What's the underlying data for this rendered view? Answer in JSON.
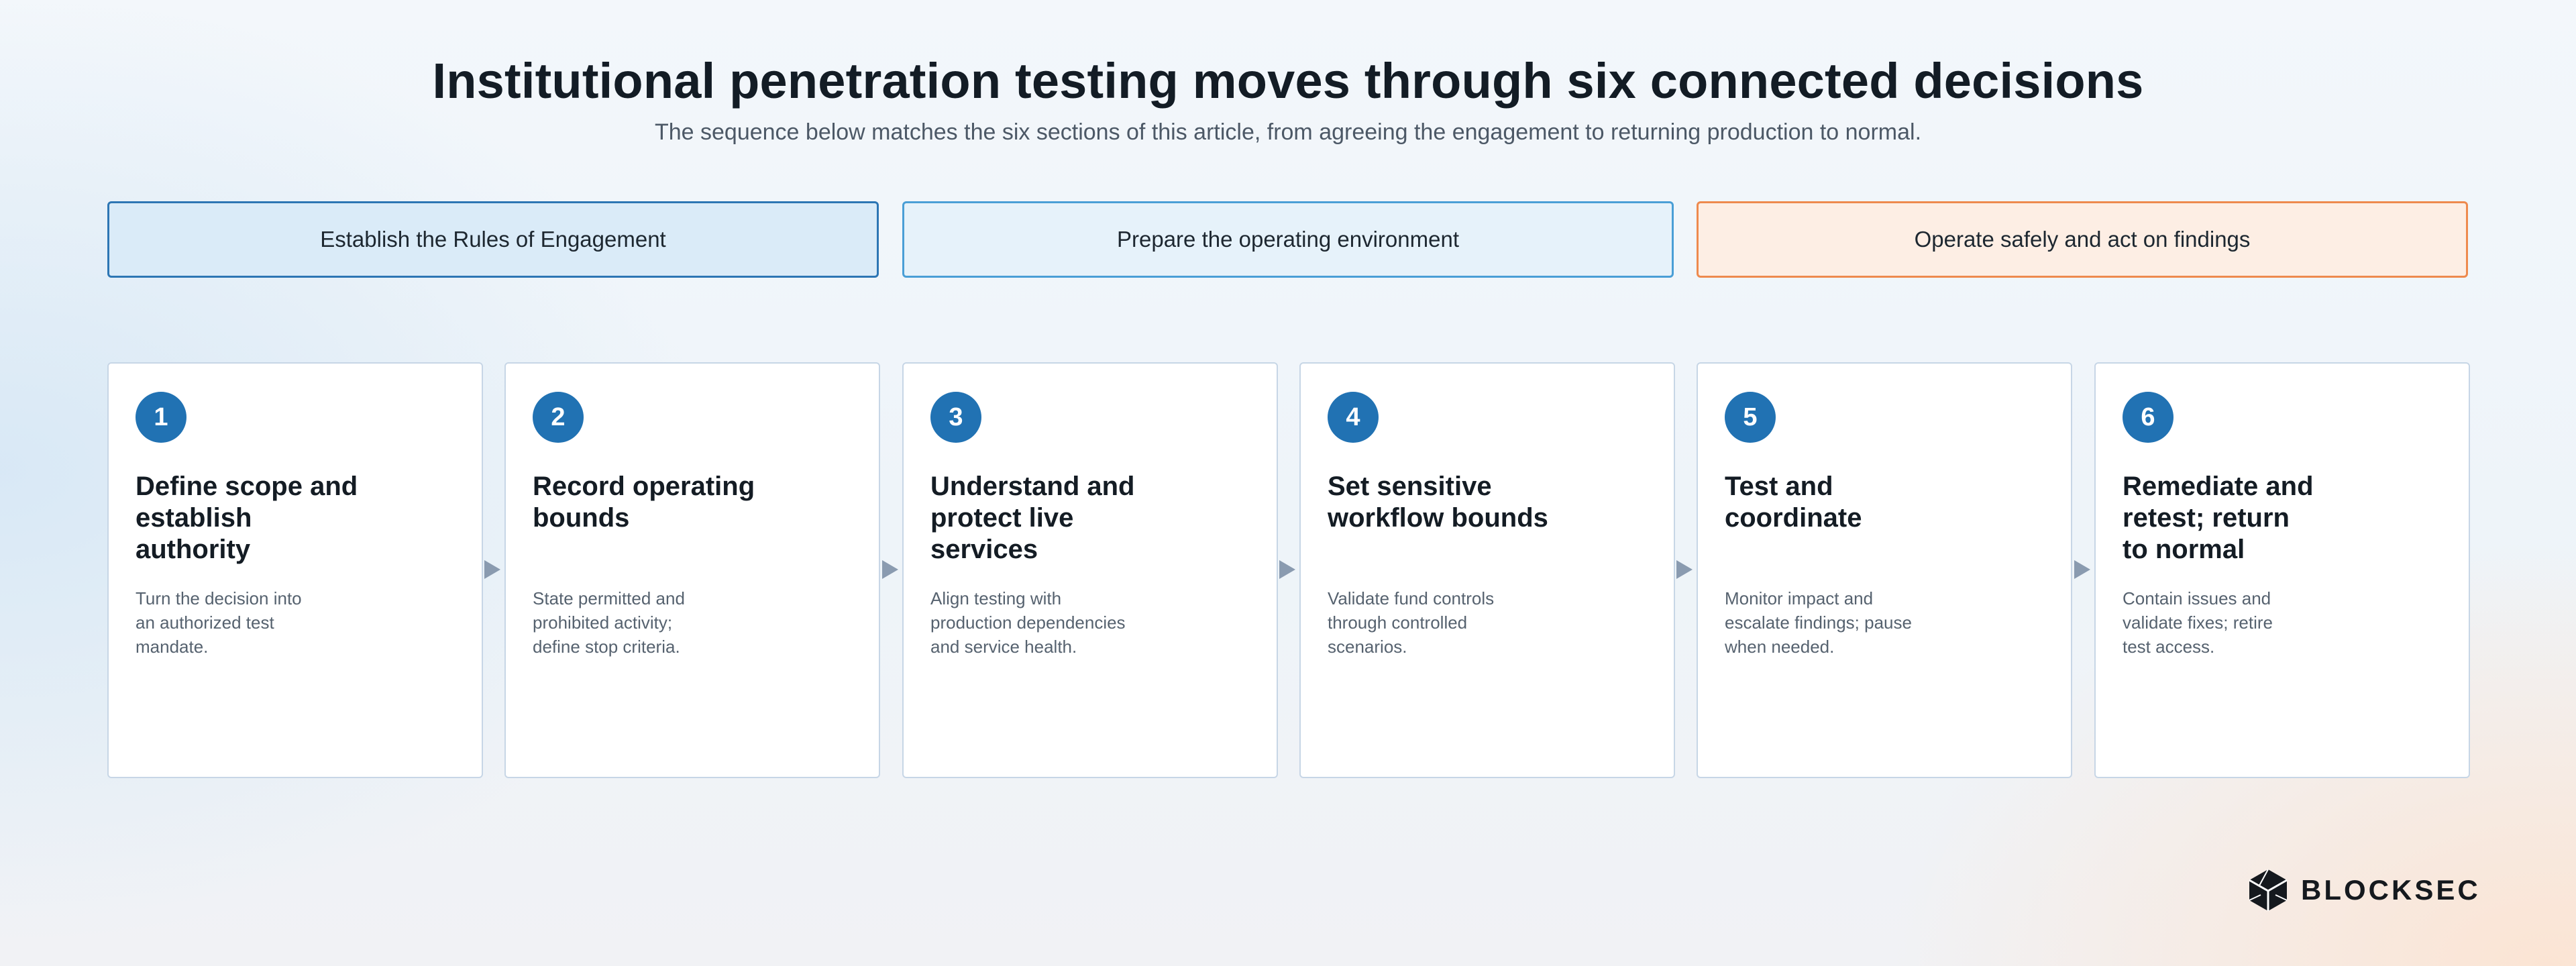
{
  "header": {
    "title": "Institutional penetration testing moves through six connected decisions",
    "subtitle": "The sequence below matches the six sections of this article, from agreeing the engagement to returning production to normal."
  },
  "phases": [
    {
      "label": "Establish the Rules of Engagement"
    },
    {
      "label": "Prepare the operating environment"
    },
    {
      "label": "Operate safely and act on findings"
    }
  ],
  "steps": [
    {
      "number": "1",
      "title": "Define scope and\nestablish\nauthority",
      "description": "Turn the decision into\nan authorized test\nmandate."
    },
    {
      "number": "2",
      "title": "Record operating\nbounds",
      "description": "State permitted and\nprohibited activity;\ndefine stop criteria."
    },
    {
      "number": "3",
      "title": "Understand and\nprotect live\nservices",
      "description": "Align testing with\nproduction dependencies\nand service health."
    },
    {
      "number": "4",
      "title": "Set sensitive\nworkflow bounds",
      "description": "Validate fund controls\nthrough controlled\nscenarios."
    },
    {
      "number": "5",
      "title": "Test and\ncoordinate",
      "description": "Monitor impact and\nescalate findings; pause\nwhen needed."
    },
    {
      "number": "6",
      "title": "Remediate and\nretest; return\nto normal",
      "description": "Contain issues and\nvalidate fixes; retire\ntest access."
    }
  ],
  "brand": {
    "name": "BLOCKSEC",
    "icon": "blocksec-logo-icon",
    "colors": {
      "accent": "#2172b3",
      "phase_1_border": "#2d76b4",
      "phase_2_border": "#4a9fd6",
      "phase_3_border": "#ee8a4e"
    }
  }
}
